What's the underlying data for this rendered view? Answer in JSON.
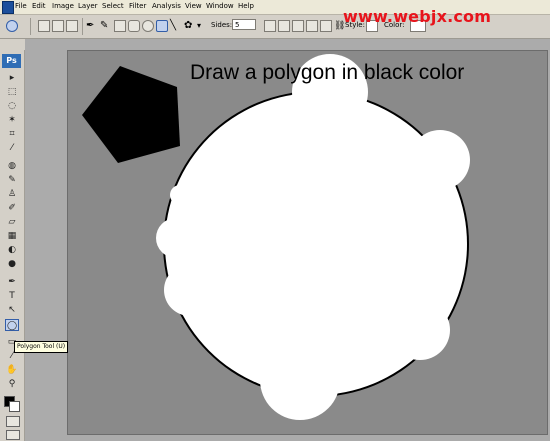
{
  "menubar": {
    "app_icon": "Ps",
    "items": [
      "File",
      "Edit",
      "Image",
      "Layer",
      "Select",
      "Filter",
      "Analysis",
      "View",
      "Window",
      "Help"
    ]
  },
  "options_bar": {
    "sides_label": "Sides:",
    "sides_value": "5",
    "style_label": "Style:",
    "color_label": "Color:"
  },
  "watermark": "www.webjx.com",
  "toolbox": {
    "logo": "Ps",
    "tooltip": "Polygon Tool (U)",
    "tools": [
      {
        "name": "move-tool-icon",
        "glyph": "▸"
      },
      {
        "name": "marquee-tool-icon",
        "glyph": "⬚"
      },
      {
        "name": "lasso-tool-icon",
        "glyph": "◌"
      },
      {
        "name": "magic-wand-tool-icon",
        "glyph": "✶"
      },
      {
        "name": "crop-tool-icon",
        "glyph": "⌗"
      },
      {
        "name": "slice-tool-icon",
        "glyph": "⁄"
      },
      {
        "name": "healing-brush-tool-icon",
        "glyph": "◍"
      },
      {
        "name": "brush-tool-icon",
        "glyph": "✎"
      },
      {
        "name": "clone-stamp-tool-icon",
        "glyph": "♙"
      },
      {
        "name": "history-brush-tool-icon",
        "glyph": "✐"
      },
      {
        "name": "eraser-tool-icon",
        "glyph": "▱"
      },
      {
        "name": "gradient-tool-icon",
        "glyph": "▦"
      },
      {
        "name": "blur-tool-icon",
        "glyph": "◐"
      },
      {
        "name": "dodge-tool-icon",
        "glyph": "●"
      },
      {
        "name": "pen-tool-icon",
        "glyph": "✒"
      },
      {
        "name": "type-tool-icon",
        "glyph": "T"
      },
      {
        "name": "path-selection-tool-icon",
        "glyph": "↖"
      },
      {
        "name": "polygon-tool-icon",
        "glyph": "◯"
      },
      {
        "name": "notes-tool-icon",
        "glyph": "▭"
      },
      {
        "name": "eyedropper-tool-icon",
        "glyph": "⁄"
      },
      {
        "name": "hand-tool-icon",
        "glyph": "✋"
      },
      {
        "name": "zoom-tool-icon",
        "glyph": "⚲"
      }
    ]
  },
  "canvas": {
    "title": "Draw a polygon in black color"
  },
  "colors": {
    "watermark": "#e8141b",
    "canvas_bg": "#8a8a8a",
    "shape_fill": "#000000",
    "circle_fill": "#ffffff"
  }
}
